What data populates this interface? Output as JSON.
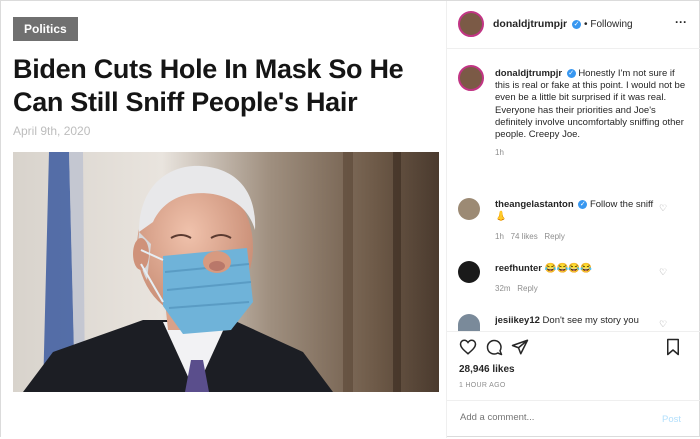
{
  "article": {
    "category": "Politics",
    "headline": "Biden Cuts Hole In Mask So He Can Still Sniff People's Hair",
    "date": "April 9th, 2020"
  },
  "post": {
    "header": {
      "username": "donaldjtrumpjr",
      "following": "Following",
      "separator": "•",
      "more": "···"
    },
    "caption": {
      "username": "donaldjtrumpjr",
      "text": "Honestly I'm not sure if this is real or fake at this point. I would not be even be a little bit surprised if it was real. Everyone has their priorities and Joe's definitely involve uncomfortably sniffing other people. Creepy Joe.",
      "time": "1h"
    },
    "comments": [
      {
        "username": "theangelastanton",
        "text": "Follow the sniff",
        "emoji": "👃",
        "time": "1h",
        "likes": "74 likes",
        "reply": "Reply"
      },
      {
        "username": "reefhunter",
        "text": "😂😂😂😂",
        "time": "32m",
        "reply": "Reply"
      },
      {
        "username": "jesiikey12",
        "text": "Don't see my story you"
      }
    ],
    "likes": "28,946 likes",
    "time_ago": "1 HOUR AGO",
    "add_comment_placeholder": "Add a comment...",
    "post_button": "Post"
  },
  "colors": {
    "verified": "#3897f0",
    "mask": "#6fb3d9",
    "category_bg": "#707070"
  }
}
